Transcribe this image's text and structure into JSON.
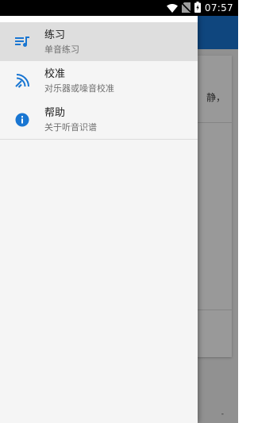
{
  "status_bar": {
    "time": "07:57",
    "icons": [
      "wifi-icon",
      "no-sim-icon",
      "battery-icon"
    ]
  },
  "background_app": {
    "card_text": "静，",
    "bottom_mark": "-",
    "toolbar_color": "#1976d2"
  },
  "drawer": {
    "items": [
      {
        "title": "练习",
        "subtitle": "单音练习",
        "icon": "practice-icon",
        "selected": true
      },
      {
        "title": "校准",
        "subtitle": "对乐器或噪音校准",
        "icon": "calibrate-icon",
        "selected": false
      },
      {
        "title": "帮助",
        "subtitle": "关于听音识谱",
        "icon": "info-icon",
        "selected": false
      }
    ],
    "icon_color": "#1976d2",
    "selected_bg": "#dedede"
  }
}
